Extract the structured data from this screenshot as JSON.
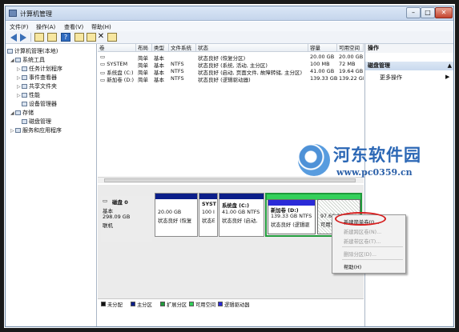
{
  "window": {
    "title": "计算机管理"
  },
  "menu": [
    "文件(F)",
    "操作(A)",
    "查看(V)",
    "帮助(H)"
  ],
  "tree": {
    "root": "计算机管理(本地)",
    "system_tools": "系统工具",
    "items": [
      "任务计划程序",
      "事件查看器",
      "共享文件夹",
      "性能",
      "设备管理器"
    ],
    "storage": "存储",
    "disk_mgmt": "磁盘管理",
    "services": "服务和应用程序"
  },
  "volumes": {
    "headers": [
      "卷",
      "布局",
      "类型",
      "文件系统",
      "状态",
      "容量",
      "可用空间"
    ],
    "rows": [
      [
        "",
        "简单",
        "基本",
        "",
        "状态良好 (恢复分区)",
        "20.00 GB",
        "20.00 GB"
      ],
      [
        "SYSTEM",
        "简单",
        "基本",
        "NTFS",
        "状态良好 (系统, 活动, 主分区)",
        "100 MB",
        "72 MB"
      ],
      [
        "系统盘 (C:)",
        "简单",
        "基本",
        "NTFS",
        "状态良好 (启动, 页面文件, 故障转储, 主分区)",
        "41.00 GB",
        "19.64 GB"
      ],
      [
        "新加卷 (D:)",
        "简单",
        "基本",
        "NTFS",
        "状态良好 (逻辑驱动器)",
        "139.33 GB",
        "139.22 GB"
      ]
    ]
  },
  "disk": {
    "name": "磁盘 0",
    "type": "基本",
    "size": "298.09 GB",
    "status": "联机",
    "partitions": [
      {
        "line1": "",
        "line2": "20.00 GB",
        "line3": "状态良好 (恢复"
      },
      {
        "line1": "SYST",
        "line2": "100 I",
        "line3": "状态E"
      },
      {
        "line1": "系统盘 (C:)",
        "line2": "41.00 GB NTFS",
        "line3": "状态良好 (启动,"
      },
      {
        "line1": "新加卷 (D:)",
        "line2": "139.33 GB NTFS",
        "line3": "状态良好 (逻辑驱"
      },
      {
        "line1": "",
        "line2": "97.66 GB",
        "line3": "可用空间"
      }
    ]
  },
  "legend": [
    "未分配",
    "主分区",
    "扩展分区",
    "可用空间",
    "逻辑驱动器"
  ],
  "actions": {
    "header": "操作",
    "section": "磁盘管理",
    "more": "更多操作"
  },
  "context_menu": [
    "新建简单卷(I)...",
    "新建跨区卷(N)...",
    "新建带区卷(T)...",
    "删除分区(D)...",
    "帮助(H)"
  ],
  "watermark": {
    "name": "河东软件园",
    "url": "www.pc0359.cn"
  },
  "colors": {
    "primary_partition": "#0c1f8a",
    "free_space": "#33d05a",
    "logical_drive": "#2a2ad8",
    "unallocated": "#111111",
    "extended_partition": "#1f9a3a",
    "highlight": "#d61f1f"
  }
}
